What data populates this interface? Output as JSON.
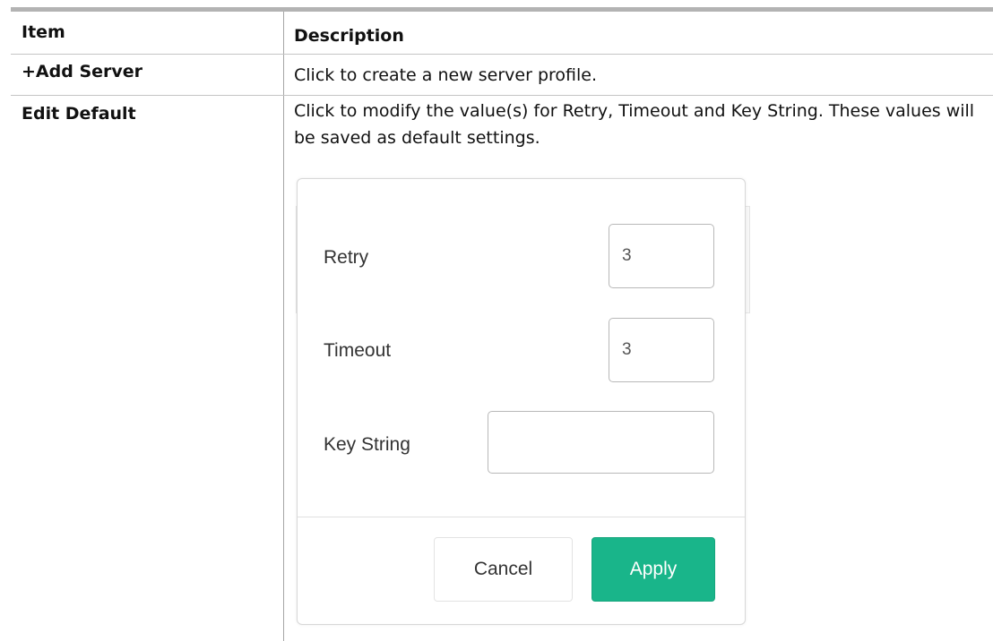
{
  "table": {
    "headers": {
      "item": "Item",
      "description": "Description"
    },
    "rows": [
      {
        "item": "+Add Server",
        "description": "Click to create a new server profile."
      },
      {
        "item": "Edit Default",
        "description": "Click to modify the value(s) for Retry, Timeout and Key String. These values will be saved as default settings."
      }
    ]
  },
  "dialog": {
    "retry": {
      "label": "Retry",
      "value": "3"
    },
    "timeout": {
      "label": "Timeout",
      "value": "3"
    },
    "key_string": {
      "label": "Key String",
      "value": ""
    },
    "cancel_label": "Cancel",
    "apply_label": "Apply",
    "colors": {
      "apply_bg": "#19b58a",
      "header_border": "#b3b3b3"
    }
  }
}
